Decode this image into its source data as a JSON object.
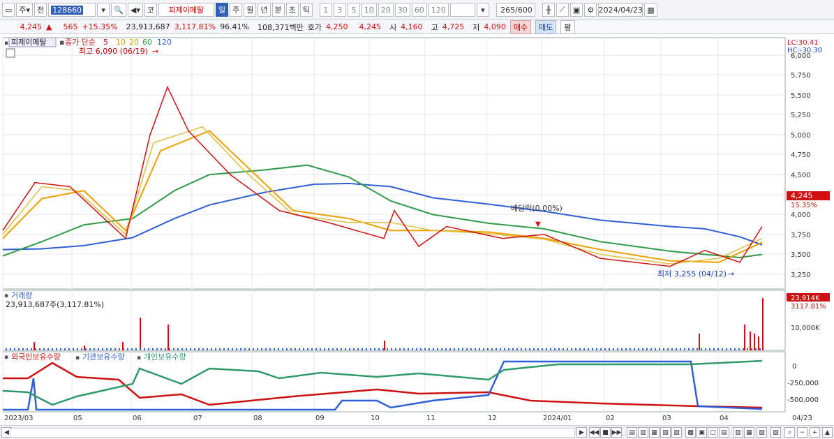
{
  "toolbar": {
    "market_select": "주",
    "mode": "전",
    "code": "128660",
    "name_prefix": "코",
    "name": "피제이메탈",
    "periods": [
      "일",
      "주",
      "월",
      "년",
      "분",
      "초",
      "틱"
    ],
    "active_period": "일",
    "intervals": [
      "1",
      "3",
      "5",
      "10",
      "20",
      "30",
      "60",
      "120"
    ],
    "count": "265",
    "count_total": "/600",
    "date": "2024/04/23"
  },
  "info": {
    "price": "4,245",
    "change_arrow": "▲",
    "change": "565",
    "change_pct": "+15.35%",
    "volume": "23,913,687",
    "volume_pct": "3,117.81%",
    "ratio": "96.41%",
    "amount": "108,371백만",
    "quote_label": "호가",
    "quote1": "4,250",
    "quote2": "4,245",
    "open_label": "시",
    "open": "4,160",
    "high_label": "고",
    "high": "4,725",
    "low_label": "저",
    "low": "4,090",
    "buy": "매수",
    "sell": "매도",
    "avg": "평"
  },
  "price_panel": {
    "name": "피제이메탈",
    "legend_prefix": "종가 단순",
    "ma_labels": [
      "5",
      "10",
      "20",
      "60",
      "120"
    ],
    "ma_colors": [
      "#d01010",
      "#e0a020",
      "#f0a000",
      "#2e9a4a",
      "#2e5fd8"
    ],
    "lc_label": "LC:30.41",
    "hc_label": "HC:-30.30",
    "high_annot": "최고 6,090 (06/19)",
    "low_annot": "최저 3,255 (04/12)",
    "dividend_annot": "배당락(0.00%)",
    "current_price": "4,245",
    "current_pct": "15.35%",
    "y_ticks": [
      "6,000",
      "5,750",
      "5,500",
      "5,250",
      "5,000",
      "4,750",
      "4,500",
      "4,250",
      "4,000",
      "3,750",
      "3,500",
      "3,250"
    ]
  },
  "volume_panel": {
    "label": "거래량",
    "value": "23,913,687주(3,117.81%)",
    "current": "23,914K",
    "current_pct": "3117.81%",
    "y_tick": "10,000K"
  },
  "holdings_panel": {
    "legends": [
      "외국인보유수량",
      "기관보유수량",
      "개인보유수량"
    ],
    "legend_colors": [
      "#d01010",
      "#2e5fd8",
      "#2e9a6a"
    ],
    "y_ticks": [
      "0",
      "-250,000",
      "-500,000"
    ]
  },
  "x_axis": [
    "2023/03",
    "05",
    "06",
    "07",
    "08",
    "09",
    "10",
    "11",
    "12",
    "2024/01",
    "02",
    "03",
    "04"
  ],
  "x_axis_right": "04/23",
  "colors": {
    "up": "#d01010",
    "down": "#1a3fbf",
    "accent": "#2e5fb8"
  }
}
